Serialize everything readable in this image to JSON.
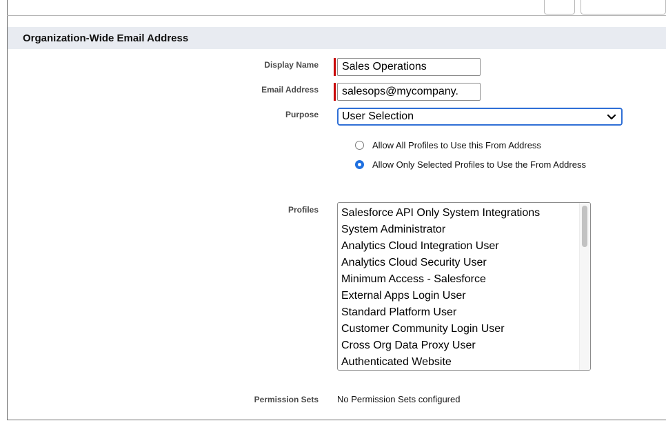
{
  "section": {
    "title": "Organization-Wide Email Address"
  },
  "fields": {
    "display_name": {
      "label": "Display Name",
      "value": "Sales Operations"
    },
    "email_address": {
      "label": "Email Address",
      "value": "salesops@mycompany."
    },
    "purpose": {
      "label": "Purpose",
      "selected": "User Selection"
    },
    "profiles": {
      "label": "Profiles",
      "options": [
        "Salesforce API Only System Integrations",
        "System Administrator",
        "Analytics Cloud Integration User",
        "Analytics Cloud Security User",
        "Minimum Access - Salesforce",
        "External Apps Login User",
        "Standard Platform User",
        "Customer Community Login User",
        "Cross Org Data Proxy User",
        "Authenticated Website"
      ]
    },
    "permission_sets": {
      "label": "Permission Sets",
      "value": "No Permission Sets configured"
    }
  },
  "radio_options": [
    {
      "label": "Allow All Profiles to Use this From Address",
      "checked": false
    },
    {
      "label": "Allow Only Selected Profiles to Use the From Address",
      "checked": true
    }
  ],
  "colors": {
    "required": "#c80000",
    "accent": "#1f70e0",
    "header_bg": "#e8ebf1"
  },
  "icons": {
    "select_arrow": "chevron-down-icon"
  }
}
